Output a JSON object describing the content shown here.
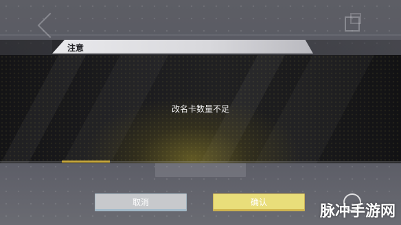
{
  "dialog": {
    "title": "注意",
    "message": "改名卡数量不足",
    "cancel_label": "取消",
    "confirm_label": "确认"
  },
  "watermark": {
    "text": "脉冲手游网"
  },
  "colors": {
    "confirm_button": "#e9de7a",
    "cancel_button": "#c7c9cc",
    "header_tab": "#e3e3e6",
    "accent": "#c9a93c"
  }
}
